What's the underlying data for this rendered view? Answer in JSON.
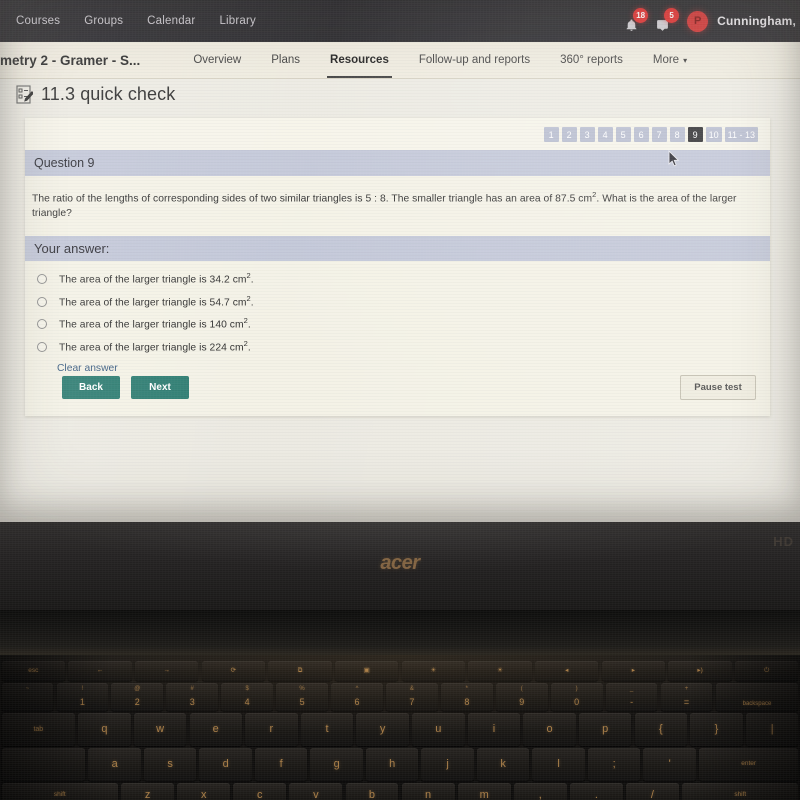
{
  "topbar": {
    "links": [
      {
        "label": "Courses"
      },
      {
        "label": "Groups"
      },
      {
        "label": "Calendar"
      },
      {
        "label": "Library"
      }
    ],
    "notifications_badge": "18",
    "messages_badge": "5",
    "avatar_initial": "P",
    "username": "Cunningham,"
  },
  "navbar": {
    "course_title": "metry 2 - Gramer - S...",
    "tabs": [
      {
        "label": "Overview",
        "active": false
      },
      {
        "label": "Plans",
        "active": false
      },
      {
        "label": "Resources",
        "active": true
      },
      {
        "label": "Follow-up and reports",
        "active": false
      },
      {
        "label": "360° reports",
        "active": false
      }
    ],
    "more_label": "More",
    "more_caret": "▾"
  },
  "page": {
    "title": "11.3 quick check"
  },
  "pager": {
    "items": [
      "1",
      "2",
      "3",
      "4",
      "5",
      "6",
      "7",
      "8",
      "9",
      "10",
      "11 - 13"
    ],
    "active": "9"
  },
  "question": {
    "header": "Question 9",
    "text_part1": "The ratio of the lengths of corresponding sides of two similar triangles is 5 : 8.  The smaller triangle has an area of 87.5 cm",
    "text_sup": "2",
    "text_part2": ". What is the area of the larger triangle?"
  },
  "answer": {
    "header": "Your answer:",
    "options": [
      {
        "prefix": "The area of the larger triangle is 34.2 cm",
        "sup": "2",
        "suffix": ".",
        "selected": false
      },
      {
        "prefix": "The area of the larger triangle is 54.7 cm",
        "sup": "2",
        "suffix": ".",
        "selected": false
      },
      {
        "prefix": "The area of the larger triangle is 140 cm",
        "sup": "2",
        "suffix": ".",
        "selected": false
      },
      {
        "prefix": "The area of the larger triangle is 224 cm",
        "sup": "2",
        "suffix": ".",
        "selected": false
      }
    ],
    "clear_label": "Clear answer"
  },
  "buttons": {
    "back": "Back",
    "next": "Next",
    "pause": "Pause test"
  },
  "hardware": {
    "brand_logo": "acer",
    "bezel_mark": "HD",
    "keyboard": {
      "fn_row": [
        "esc",
        "←",
        "→",
        "⟳",
        "⧉",
        "▣",
        "☀",
        "☀",
        "◂",
        "▸",
        "▸)",
        "⏻"
      ],
      "num_row": [
        {
          "top": "~",
          "main": ""
        },
        {
          "top": "!",
          "main": "1"
        },
        {
          "top": "@",
          "main": "2"
        },
        {
          "top": "#",
          "main": "3"
        },
        {
          "top": "$",
          "main": "4"
        },
        {
          "top": "%",
          "main": "5"
        },
        {
          "top": "^",
          "main": "6"
        },
        {
          "top": "&",
          "main": "7"
        },
        {
          "top": "*",
          "main": "8"
        },
        {
          "top": "(",
          "main": "9"
        },
        {
          "top": ")",
          "main": "0"
        },
        {
          "top": "_",
          "main": "-"
        },
        {
          "top": "+",
          "main": "="
        },
        {
          "top": "",
          "main": "backspace"
        }
      ],
      "q_row": [
        "tab",
        "q",
        "w",
        "e",
        "r",
        "t",
        "y",
        "u",
        "i",
        "o",
        "p",
        "{",
        "}",
        "|"
      ],
      "a_row": [
        "",
        "a",
        "s",
        "d",
        "f",
        "g",
        "h",
        "j",
        "k",
        "l",
        ";",
        "'",
        "enter"
      ],
      "z_row": [
        "shift",
        "z",
        "x",
        "c",
        "v",
        "b",
        "n",
        "m",
        ",",
        ".",
        "/",
        "shift"
      ]
    }
  },
  "colors": {
    "accent_button": "#2e7d72",
    "badge_red": "#e02b2b",
    "pager_inactive": "#b8bdd0",
    "pager_active": "#2f2f33",
    "section_header": "#c2c7d8",
    "topbar_bg": "#262529",
    "navbar_bg": "#eeeade",
    "card_bg": "#f4f2e6",
    "acer_logo": "#8c6a45"
  }
}
